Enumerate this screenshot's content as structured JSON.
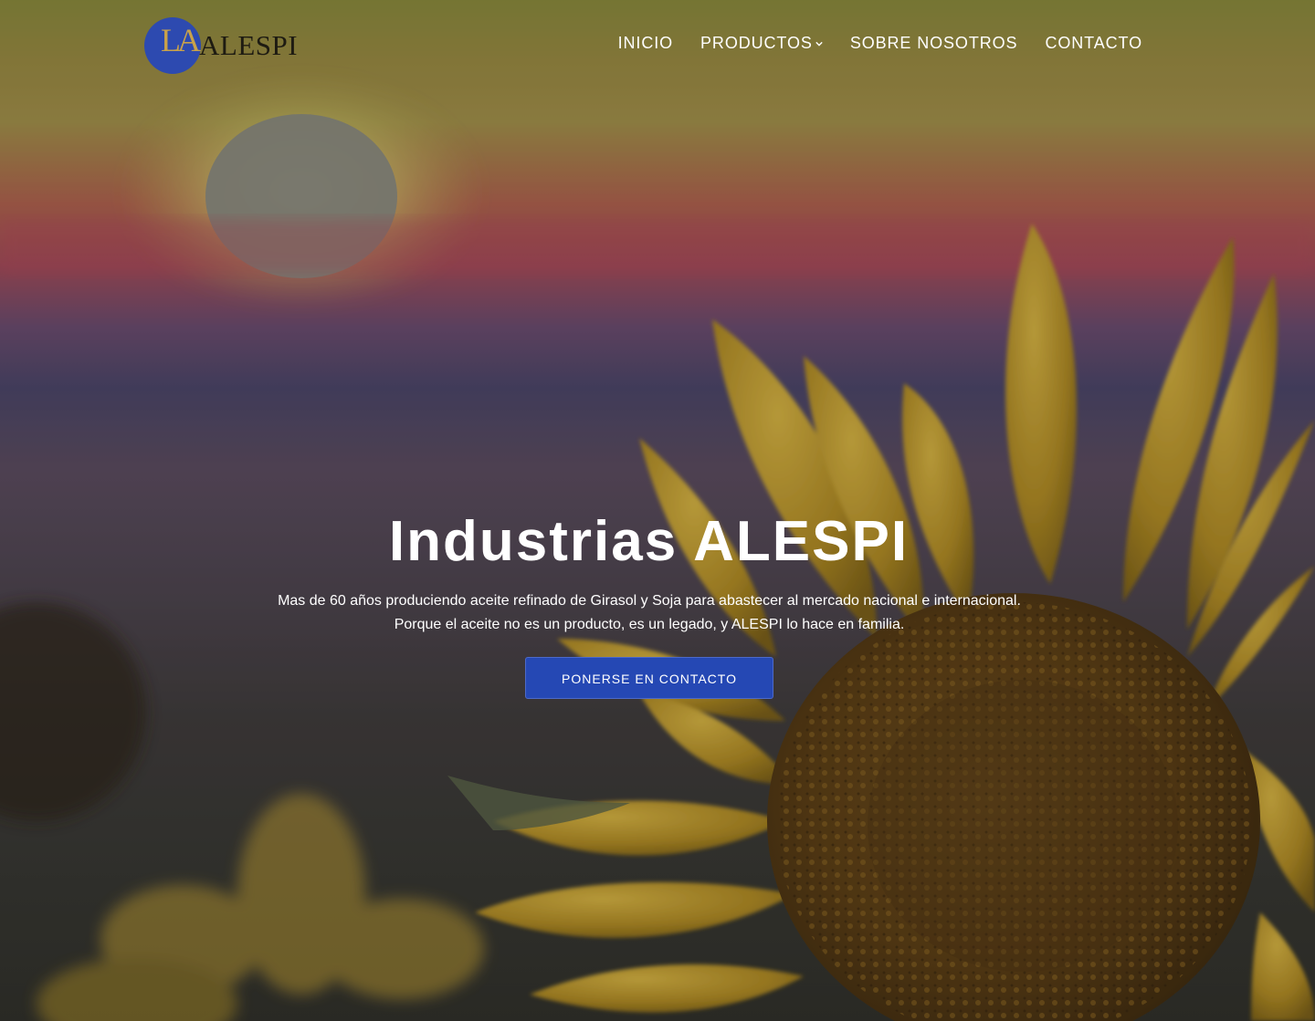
{
  "brand": {
    "logo_mark": "LA",
    "name": "ALESPI"
  },
  "nav": {
    "items": [
      {
        "label": "INICIO"
      },
      {
        "label": "PRODUCTOS",
        "has_dropdown": true
      },
      {
        "label": "SOBRE NOSOTROS"
      },
      {
        "label": "CONTACTO"
      }
    ]
  },
  "hero": {
    "title": "Industrias ALESPI",
    "subtitle_line1": "Mas de 60 años produciendo aceite refinado de Girasol y Soja para abastecer al mercado nacional e internacional.",
    "subtitle_line2": "Porque el aceite no es un producto, es un legado, y ALESPI lo hace en familia.",
    "cta_label": "PONERSE EN CONTACTO",
    "background_image": "sunflower-at-sunset"
  },
  "colors": {
    "brand_blue": "#2d4ab0",
    "cta_blue": "#2548b4",
    "logo_gold": "#c9a24a",
    "text_white": "#ffffff"
  }
}
